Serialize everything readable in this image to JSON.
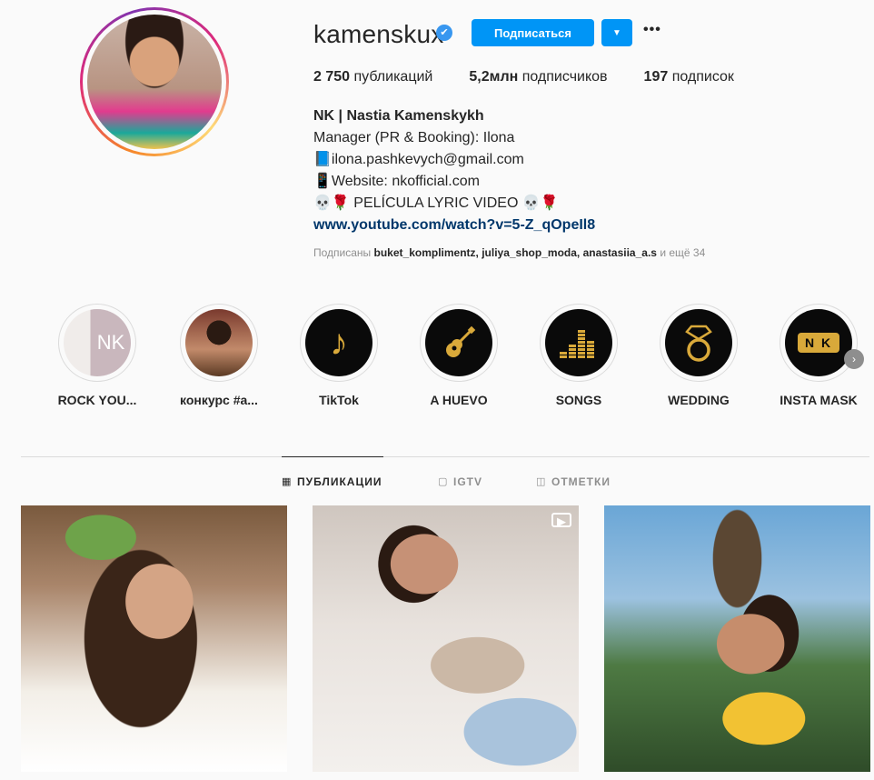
{
  "profile": {
    "username": "kamenskux",
    "verified_mark": "✔",
    "follow_label": "Подписаться",
    "dropdown_label": "▼",
    "more_label": "•••"
  },
  "stats": {
    "posts_value": "2 750",
    "posts_label": "публикаций",
    "followers_value": "5,2млн",
    "followers_label": "подписчиков",
    "following_value": "197",
    "following_label": "подписок"
  },
  "bio": {
    "name": "NK | Nastia Kamenskykh",
    "line1": "Manager (PR & Booking): Ilona",
    "line2": "📘ilona.pashkevych@gmail.com",
    "line3": "📱Website: nkofficial.com",
    "line4": "💀🌹 PELÍCULA LYRIC VIDEO 💀🌹",
    "link": "www.youtube.com/watch?v=5-Z_qOpeIl8"
  },
  "followed_by": {
    "prefix": "Подписаны",
    "names": "buket_komplimentz, juliya_shop_moda, anastasiia_a.s",
    "suffix": "и ещё 34"
  },
  "highlights": [
    {
      "label": "ROCK YOU...",
      "icon": "nk-logo-icon",
      "glyph": "NK"
    },
    {
      "label": "конкурс #a...",
      "icon": "photo-thumbnail",
      "glyph": ""
    },
    {
      "label": "TikTok",
      "icon": "tiktok-icon",
      "glyph": "♪"
    },
    {
      "label": "A HUEVO",
      "icon": "guitar-icon",
      "glyph": "🎸"
    },
    {
      "label": "SONGS",
      "icon": "equalizer-icon",
      "glyph": "▂▄▆█"
    },
    {
      "label": "WEDDING",
      "icon": "ring-icon",
      "glyph": "💍"
    },
    {
      "label": "INSTA MASK",
      "icon": "nk-mask-icon",
      "glyph": "N K"
    }
  ],
  "tabs": {
    "posts": "ПУБЛИКАЦИИ",
    "igtv": "IGTV",
    "tagged": "ОТМЕТКИ"
  },
  "icons": {
    "grid": "▦",
    "igtv": "▢",
    "tagged": "◫",
    "video": "▶",
    "next": "›"
  },
  "colors": {
    "accent": "#0095f6",
    "verified": "#3897f0",
    "link": "#00376b",
    "gold": "#d9a93a"
  }
}
